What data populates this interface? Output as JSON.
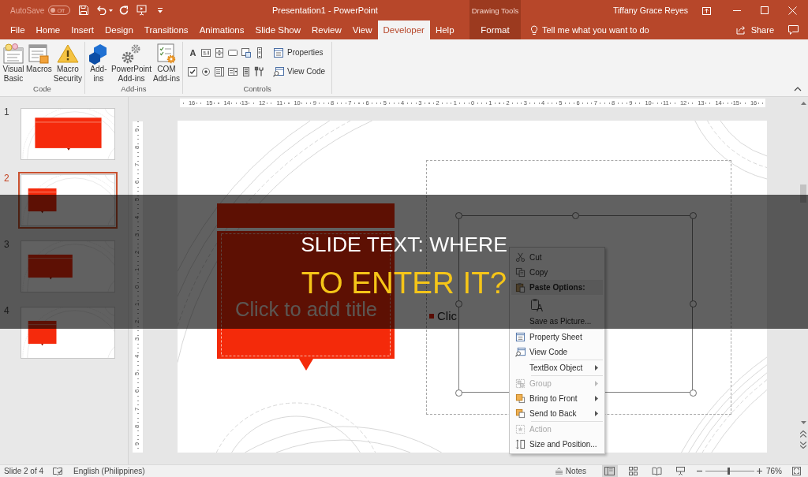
{
  "title_bar": {
    "autosave_label": "AutoSave",
    "autosave": {
      "on": false,
      "label": "Off"
    },
    "title": "Presentation1 - PowerPoint",
    "context_header": "Drawing Tools",
    "user": "Tiffany Grace Reyes"
  },
  "tabs": [
    {
      "label": "File",
      "kind": "normal",
      "selected": false
    },
    {
      "label": "Home",
      "kind": "normal",
      "selected": false
    },
    {
      "label": "Insert",
      "kind": "normal",
      "selected": false
    },
    {
      "label": "Design",
      "kind": "normal",
      "selected": false
    },
    {
      "label": "Transitions",
      "kind": "normal",
      "selected": false
    },
    {
      "label": "Animations",
      "kind": "normal",
      "selected": false
    },
    {
      "label": "Slide Show",
      "kind": "normal",
      "selected": false
    },
    {
      "label": "Review",
      "kind": "normal",
      "selected": false
    },
    {
      "label": "View",
      "kind": "normal",
      "selected": false
    },
    {
      "label": "Developer",
      "kind": "normal",
      "selected": true
    },
    {
      "label": "Help",
      "kind": "normal",
      "selected": false
    },
    {
      "label": "Format",
      "kind": "contextual",
      "selected": false
    }
  ],
  "tell_me": {
    "placeholder": "Tell me what you want to do"
  },
  "share": {
    "label": "Share"
  },
  "ribbon": {
    "groups": [
      {
        "label": "Code",
        "kind": "large",
        "buttons": [
          {
            "label": "Visual Basic"
          },
          {
            "label": "Macros"
          },
          {
            "label": "Macro Security"
          }
        ]
      },
      {
        "label": "Add-ins",
        "kind": "large",
        "buttons": [
          {
            "label": "Add-ins"
          },
          {
            "label": "PowerPoint Add-ins"
          },
          {
            "label": "COM Add-ins"
          }
        ]
      },
      {
        "label": "Controls",
        "kind": "controls",
        "controls": [
          {
            "kind": "label",
            "glyph": "A"
          },
          {
            "kind": "text-box"
          },
          {
            "kind": "spin-button"
          },
          {
            "kind": "command-button"
          },
          {
            "kind": "image"
          },
          {
            "kind": "scroll-bar"
          },
          {
            "kind": "check-box"
          },
          {
            "kind": "option-button"
          },
          {
            "kind": "list-box"
          },
          {
            "kind": "combo-box"
          },
          {
            "kind": "toggle-button"
          },
          {
            "kind": "more-controls"
          }
        ],
        "buttons": [
          {
            "label": "Properties"
          },
          {
            "label": "View Code"
          }
        ]
      }
    ]
  },
  "slides": [
    {
      "number": "1",
      "kind": "large",
      "selected": false
    },
    {
      "number": "2",
      "kind": "small",
      "selected": true
    },
    {
      "number": "3",
      "kind": "medium",
      "selected": false
    },
    {
      "number": "4",
      "kind": "small",
      "selected": false
    }
  ],
  "rulers": {
    "horizontal": [
      "16",
      "15",
      "14",
      "13",
      "12",
      "11",
      "10",
      "9",
      "8",
      "7",
      "6",
      "5",
      "4",
      "3",
      "2",
      "1",
      "0",
      "1",
      "2",
      "3",
      "4",
      "5",
      "6",
      "7",
      "8",
      "9",
      "10",
      "11",
      "12",
      "13",
      "14",
      "15",
      "16"
    ],
    "vertical": [
      "9",
      "8",
      "7",
      "6",
      "5",
      "4",
      "3",
      "2",
      "1",
      "0",
      "1",
      "2",
      "3",
      "4",
      "5",
      "6",
      "7",
      "8",
      "9"
    ]
  },
  "slide": {
    "title_placeholder": {
      "placeholder": "Click to add title"
    },
    "content_placeholder": {
      "placeholder": "Clic"
    }
  },
  "context_menu": {
    "sections": [
      [
        {
          "kind": "command",
          "label": "Cut",
          "disabled": false,
          "submenu": false
        },
        {
          "kind": "command",
          "label": "Copy",
          "disabled": false,
          "submenu": false
        },
        {
          "kind": "header",
          "label": "Paste Options:",
          "disabled": false,
          "submenu": false
        },
        {
          "kind": "paste-options",
          "options": [
            {
              "glyph": "A"
            }
          ],
          "disabled": false,
          "submenu": false
        },
        {
          "kind": "command",
          "label": "Save as Picture...",
          "disabled": false,
          "submenu": false
        }
      ],
      [
        {
          "kind": "command",
          "label": "Property Sheet",
          "disabled": false,
          "submenu": false
        },
        {
          "kind": "command",
          "label": "View Code",
          "disabled": false,
          "submenu": false
        }
      ],
      [
        {
          "kind": "command",
          "label": "TextBox Object",
          "disabled": false,
          "submenu": true
        }
      ],
      [
        {
          "kind": "command",
          "label": "Group",
          "disabled": true,
          "submenu": true
        },
        {
          "kind": "command",
          "label": "Bring to Front",
          "disabled": false,
          "submenu": true
        },
        {
          "kind": "command",
          "label": "Send to Back",
          "disabled": false,
          "submenu": true
        }
      ],
      [
        {
          "kind": "command",
          "label": "Action",
          "disabled": true,
          "submenu": false
        },
        {
          "kind": "command",
          "label": "Size and Position...",
          "disabled": false,
          "submenu": false
        }
      ]
    ]
  },
  "banner": {
    "lines": [
      {
        "text": "SLIDE TEXT: WHERE",
        "highlighted": false
      },
      {
        "text": "TO ENTER IT?",
        "highlighted": true
      }
    ]
  },
  "status_bar": {
    "slide_indicator": "Slide 2 of 4",
    "language": "English (Philippines)",
    "notes": "Notes",
    "views": [
      {
        "kind": "normal",
        "selected": true
      },
      {
        "kind": "slide-sorter",
        "selected": false
      },
      {
        "kind": "reading",
        "selected": false
      },
      {
        "kind": "slide-show",
        "selected": false
      }
    ],
    "zoom": {
      "level": 0.48,
      "reading": "76%"
    }
  }
}
